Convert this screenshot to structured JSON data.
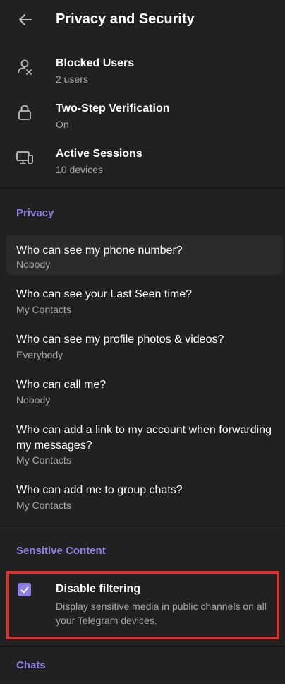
{
  "header": {
    "title": "Privacy and Security"
  },
  "top_items": [
    {
      "title": "Blocked Users",
      "subtitle": "2 users",
      "icon": "blocked-user-icon"
    },
    {
      "title": "Two-Step Verification",
      "subtitle": "On",
      "icon": "lock-icon"
    },
    {
      "title": "Active Sessions",
      "subtitle": "10 devices",
      "icon": "devices-icon"
    }
  ],
  "privacy": {
    "header": "Privacy",
    "items": [
      {
        "title": "Who can see my phone number?",
        "value": "Nobody"
      },
      {
        "title": "Who can see your Last Seen time?",
        "value": "My Contacts"
      },
      {
        "title": "Who can see my profile photos & videos?",
        "value": "Everybody"
      },
      {
        "title": "Who can call me?",
        "value": "Nobody"
      },
      {
        "title_line1": "Who can add a link to my account when forwarding",
        "title_line2": "my messages?",
        "value": "My Contacts"
      },
      {
        "title": "Who can add me to group chats?",
        "value": "My Contacts"
      }
    ]
  },
  "sensitive": {
    "header": "Sensitive Content",
    "title": "Disable filtering",
    "description": "Display sensitive media in public channels on all your Telegram devices.",
    "checked": true
  },
  "chats": {
    "header": "Chats"
  },
  "colors": {
    "accent": "#8d7ee0",
    "background": "#212121",
    "highlight_border": "#d9342f"
  }
}
